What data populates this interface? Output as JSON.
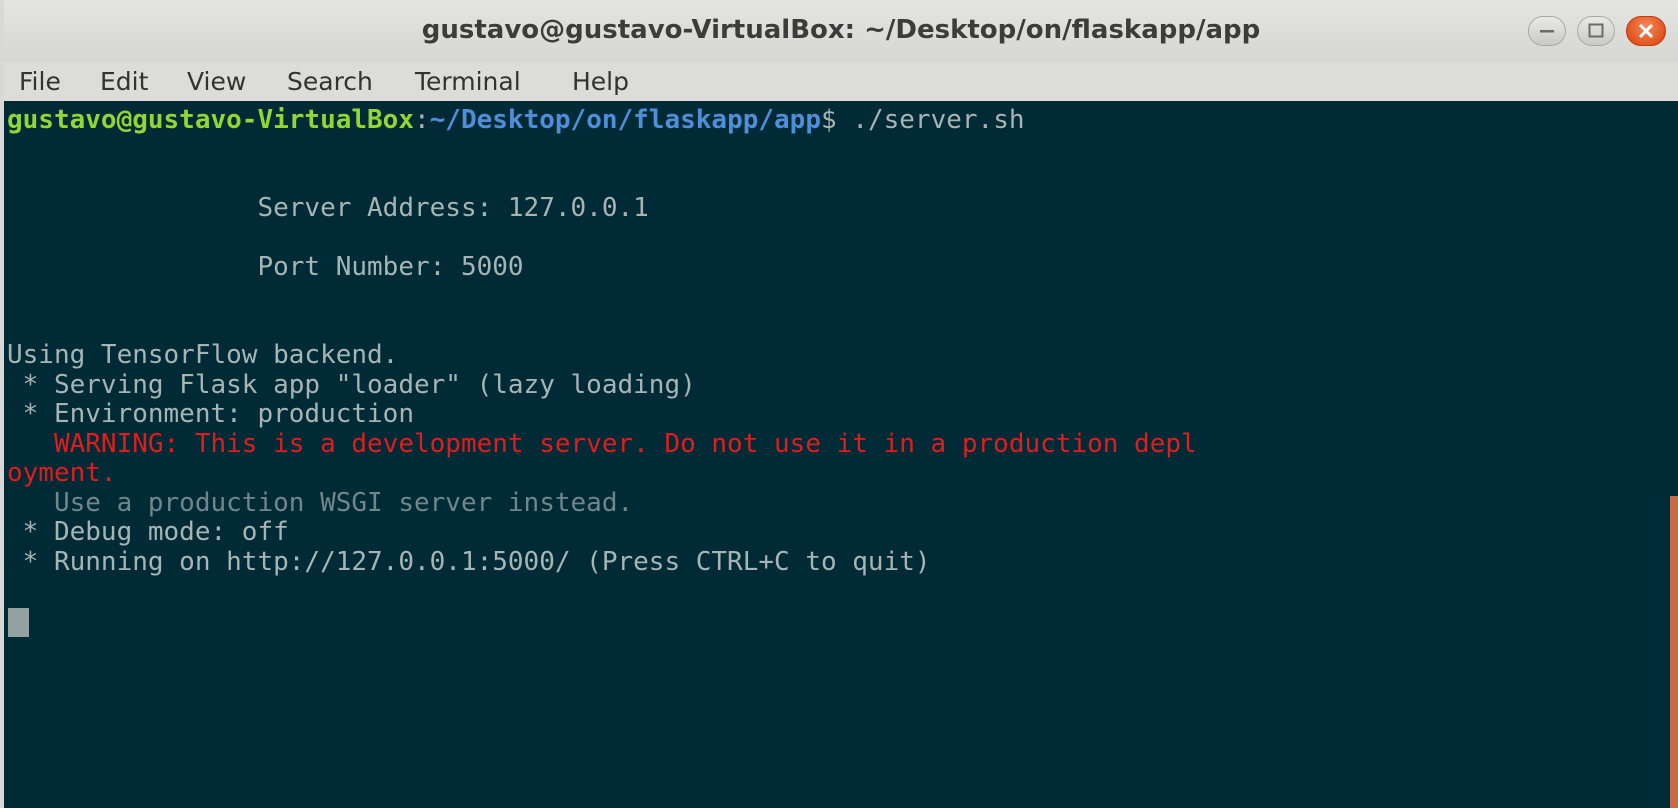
{
  "window": {
    "title": "gustavo@gustavo-VirtualBox: ~/Desktop/on/flaskapp/app",
    "buttons": [
      "minimize-icon",
      "maximize-icon",
      "close-icon"
    ]
  },
  "menubar": {
    "items": [
      "File",
      "Edit",
      "View",
      "Search",
      "Terminal",
      "Help"
    ]
  },
  "terminal": {
    "prompt_user_host": "gustavo@gustavo-VirtualBox",
    "prompt_sep": ":",
    "prompt_path": "~/Desktop/on/flaskapp/app",
    "prompt_symbol": "$ ",
    "command": "./server.sh",
    "lines": {
      "server_address": "                Server Address: 127.0.0.1",
      "port_number": "                Port Number: 5000",
      "tensorflow": "Using TensorFlow backend.",
      "serving": " * Serving Flask app \"loader\" (lazy loading)",
      "environment": " * Environment: production",
      "warning_1": "   WARNING: This is a development server. Do not use it in a production depl",
      "warning_2": "oyment.",
      "wsgi_hint": "   Use a production WSGI server instead.",
      "debug": " * Debug mode: off",
      "running": " * Running on http://127.0.0.1:5000/ (Press CTRL+C to quit)"
    }
  },
  "colors": {
    "background": "#002b36",
    "prompt_green": "#8ed734",
    "prompt_blue": "#4f8fd8",
    "warning_red": "#e01c1c",
    "scrollbar": "#c66b46"
  }
}
